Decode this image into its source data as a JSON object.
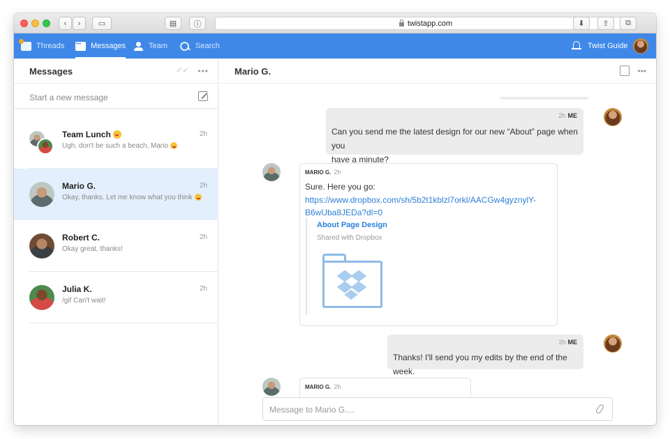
{
  "browser": {
    "url": "twistapp.com"
  },
  "nav": {
    "items": [
      {
        "label": "Threads"
      },
      {
        "label": "Messages"
      },
      {
        "label": "Team"
      },
      {
        "label": "Search"
      }
    ],
    "active": "Messages",
    "user": "Twist Guide",
    "accent": "#3f88e8"
  },
  "sidebar": {
    "title": "Messages",
    "new_message_placeholder": "Start a new message",
    "conversations": [
      {
        "name": "Team Lunch",
        "preview": "Ugh, don't be such a beach, Mario",
        "time": "2h",
        "emoji": true
      },
      {
        "name": "Mario G.",
        "preview": "Okay, thanks. Let me know what you think",
        "time": "2h",
        "emoji": true,
        "selected": true
      },
      {
        "name": "Robert C.",
        "preview": "Okay great, thanks!",
        "time": "2h"
      },
      {
        "name": "Julia K.",
        "preview": "/gif Can't wait!",
        "time": "2h"
      }
    ],
    "selected_bg": "#e3effc"
  },
  "main": {
    "title": "Mario G.",
    "messages": [
      {
        "from": "ME",
        "time": "2h",
        "text_line1": "Can you send me the latest design for our new “About” page when you",
        "text_line2": "have a minute?"
      },
      {
        "from": "MARIO G.",
        "time": "2h",
        "text": "Sure. Here you go:",
        "link_line1": "https://www.dropbox.com/sh/5b2t1kblzl7orkl/AACGw4gyznylY-",
        "link_line2": "B6wUba8JEDa?dl=0",
        "preview_title": "About Page Design",
        "preview_sub": "Shared with Dropbox"
      },
      {
        "from": "ME",
        "time": "2h",
        "text": "Thanks! I'll send you my edits by the end of the week."
      },
      {
        "from": "MARIO G.",
        "time": "2h"
      }
    ],
    "composer_placeholder": "Message to Mario G...."
  }
}
